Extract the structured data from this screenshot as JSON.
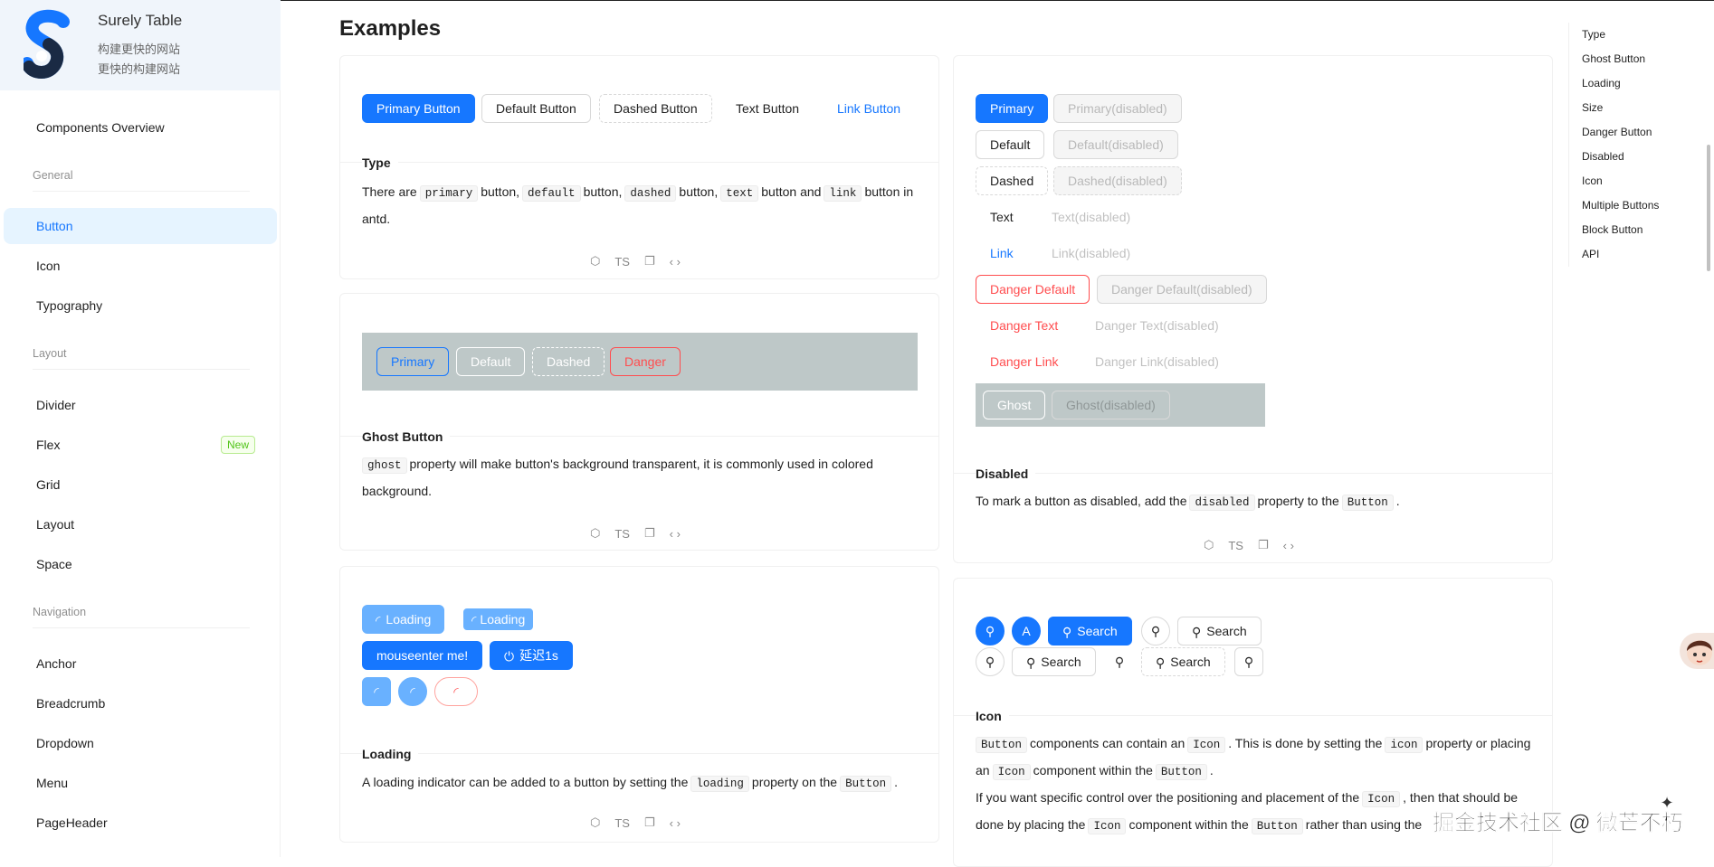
{
  "brand": {
    "name": "Surely Table",
    "tagline1": "构建更快的网站",
    "tagline2": "更快的构建网站"
  },
  "sidebar": {
    "overview": "Components Overview",
    "groups": {
      "general": "General",
      "layout": "Layout",
      "navigation": "Navigation"
    },
    "items": {
      "button": "Button",
      "icon": "Icon",
      "typography": "Typography",
      "divider": "Divider",
      "flex": "Flex",
      "flex_badge": "New",
      "grid": "Grid",
      "layout": "Layout",
      "space": "Space",
      "anchor": "Anchor",
      "breadcrumb": "Breadcrumb",
      "dropdown": "Dropdown",
      "menu": "Menu",
      "pageheader": "PageHeader"
    }
  },
  "main": {
    "title": "Examples",
    "actions": {
      "ts": "TS"
    },
    "type_demo": {
      "buttons": [
        "Primary Button",
        "Default Button",
        "Dashed Button",
        "Text Button",
        "Link Button"
      ],
      "title": "Type",
      "desc": {
        "p1": "There are",
        "c1": "primary",
        "p2": "button,",
        "c2": "default",
        "p3": "button,",
        "c3": "dashed",
        "p4": "button,",
        "c4": "text",
        "p5": "button and",
        "c5": "link",
        "p6": "button in antd."
      }
    },
    "ghost_demo": {
      "buttons": [
        "Primary",
        "Default",
        "Dashed",
        "Danger"
      ],
      "title": "Ghost Button",
      "desc": {
        "c1": "ghost",
        "p1": "property will make button's background transparent, it is commonly used in colored background."
      }
    },
    "loading_demo": {
      "buttons": {
        "loading1": "Loading",
        "loading2": "Loading",
        "mouseenter": "mouseenter me!",
        "delay": "延迟1s"
      },
      "title": "Loading",
      "desc": {
        "p1": "A loading indicator can be added to a button by setting the",
        "c1": "loading",
        "p2": "property on the",
        "c2": "Button",
        "p3": "."
      }
    },
    "disabled_demo": {
      "rows": {
        "primary": "Primary",
        "primary_dis": "Primary(disabled)",
        "default": "Default",
        "default_dis": "Default(disabled)",
        "dashed": "Dashed",
        "dashed_dis": "Dashed(disabled)",
        "text": "Text",
        "text_dis": "Text(disabled)",
        "link": "Link",
        "link_dis": "Link(disabled)",
        "danger_default": "Danger Default",
        "danger_default_dis": "Danger Default(disabled)",
        "danger_text": "Danger Text",
        "danger_text_dis": "Danger Text(disabled)",
        "danger_link": "Danger Link",
        "danger_link_dis": "Danger Link(disabled)",
        "ghost": "Ghost",
        "ghost_dis": "Ghost(disabled)"
      },
      "title": "Disabled",
      "desc": {
        "p1": "To mark a button as disabled, add the",
        "c1": "disabled",
        "p2": "property to the",
        "c2": "Button",
        "p3": "."
      }
    },
    "icon_demo": {
      "search": "Search",
      "letter": "A",
      "title": "Icon",
      "desc": {
        "c1": "Button",
        "p1": "components can contain an",
        "c2": "Icon",
        "p2": ". This is done by setting the",
        "c3": "icon",
        "p3": "property or placing an",
        "c4": "Icon",
        "p4": "component within the",
        "c5": "Button",
        "p5": ".",
        "p6": "If you want specific control over the positioning and placement of the",
        "c6": "Icon",
        "p7": ", then that should be done by placing the",
        "c7": "Icon",
        "p8": "component within the",
        "c8": "Button",
        "p9": "rather than using the"
      }
    }
  },
  "toc": [
    "Type",
    "Ghost Button",
    "Loading",
    "Size",
    "Danger Button",
    "Disabled",
    "Icon",
    "Multiple Buttons",
    "Block Button",
    "API"
  ],
  "watermark": "掘金技术社区 @ 微芒不朽",
  "colors": {
    "primary": "#1677ff",
    "danger": "#ff4d4f",
    "ghost_bg": "#bec8c8",
    "active_bg": "#e6f4ff"
  }
}
